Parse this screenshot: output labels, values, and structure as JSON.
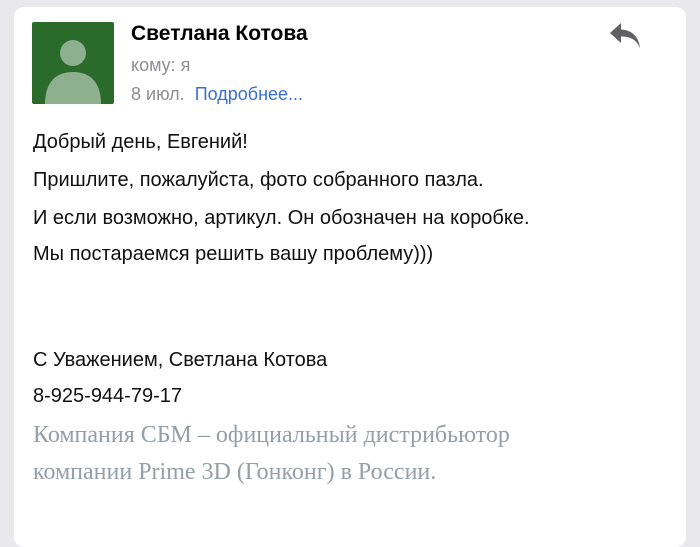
{
  "header": {
    "sender_name": "Светлана Котова",
    "to_line": "кому: я",
    "date": "8 июл.",
    "details_link": "Подробнее..."
  },
  "icons": {
    "avatar": "person-avatar-icon",
    "reply": "reply-arrow-icon"
  },
  "colors": {
    "avatar_bg": "#2a6b2c",
    "link": "#3a6fd0",
    "signature_company": "#93a0ab"
  },
  "body": {
    "greeting": "Добрый день, Евгений!",
    "line1": "Пришлите, пожалуйста, фото собранного пазла.",
    "line2": "И если возможно, артикул. Он обозначен на коробке.",
    "line3": "Мы постараемся решить вашу проблему)))"
  },
  "signature": {
    "regards": "С Уважением, Светлана Котова",
    "phone": "8-925-944-79-17",
    "company_line1": "Компания СБМ – официальный дистрибьютор",
    "company_line2": "компании Prime 3D (Гонконг) в России."
  }
}
